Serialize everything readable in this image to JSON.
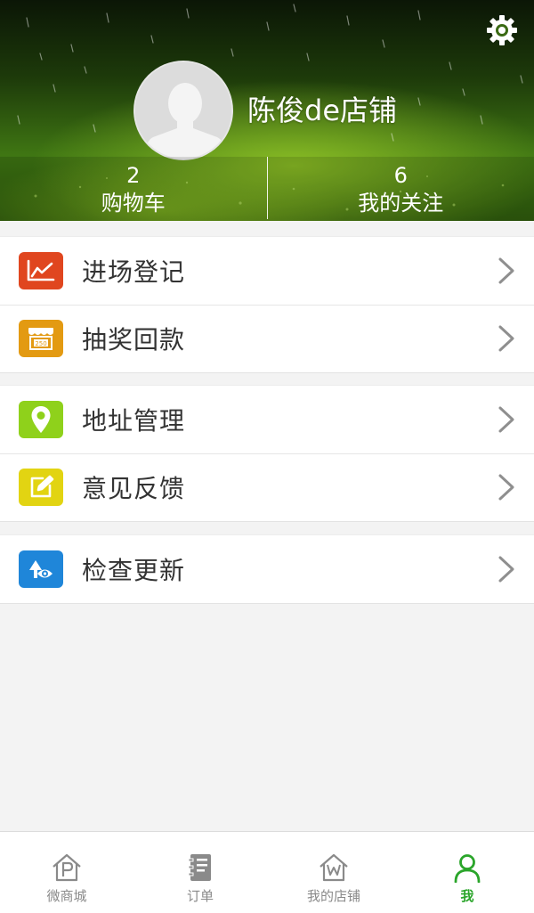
{
  "header": {
    "shop_name": "陈俊de店铺",
    "stats": [
      {
        "value": "2",
        "label": "购物车"
      },
      {
        "value": "6",
        "label": "我的关注"
      }
    ]
  },
  "menu": {
    "groups": [
      [
        {
          "label": "进场登记",
          "icon": "line-chart-icon",
          "color": "#e0461f"
        },
        {
          "label": "抽奖回款",
          "icon": "storefront-icon",
          "color": "#e39a12"
        }
      ],
      [
        {
          "label": "地址管理",
          "icon": "location-pin-icon",
          "color": "#8fd11b"
        },
        {
          "label": "意见反馈",
          "icon": "edit-note-icon",
          "color": "#e2d412"
        }
      ],
      [
        {
          "label": "检查更新",
          "icon": "update-eye-icon",
          "color": "#1f86d9"
        }
      ]
    ]
  },
  "tabbar": {
    "tabs": [
      {
        "label": "微商城",
        "icon": "house-p-icon",
        "active": false
      },
      {
        "label": "订单",
        "icon": "notebook-icon",
        "active": false
      },
      {
        "label": "我的店铺",
        "icon": "house-w-icon",
        "active": false
      },
      {
        "label": "我",
        "icon": "person-icon",
        "active": true
      }
    ],
    "active_color": "#2aa52a",
    "inactive_color": "#8a8a8a"
  }
}
